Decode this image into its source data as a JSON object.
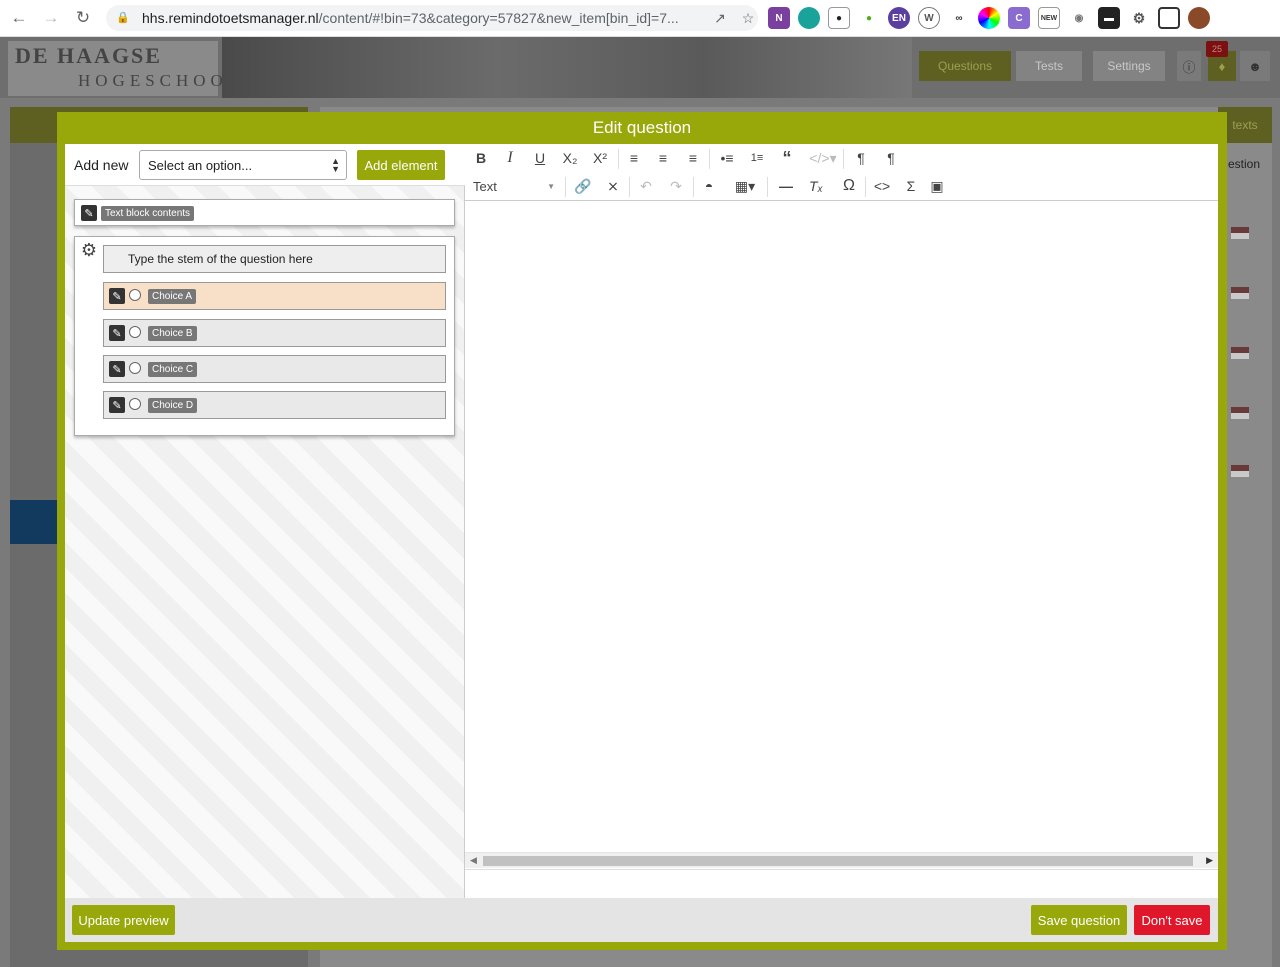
{
  "browser": {
    "url_main": "hhs.remindotoetsmanager.nl",
    "url_rest": "/content/#!bin=73&category=57827&new_item[bin_id]=7..."
  },
  "app": {
    "logo_line1": "DE HAAGSE",
    "logo_line2": "HOGESCHOOL",
    "nav": {
      "questions": "Questions",
      "tests": "Tests",
      "settings": "Settings"
    },
    "notification_count": "25",
    "right_tab_1": "texts",
    "right_tab_2": "estion"
  },
  "modal": {
    "title": "Edit question",
    "add_new_label": "Add new",
    "select_placeholder": "Select an option...",
    "add_element_label": "Add element",
    "text_block_label": "Text block contents",
    "stem_text": "Type the stem of the question here",
    "choices": [
      "Choice A",
      "Choice B",
      "Choice C",
      "Choice D"
    ],
    "editor": {
      "format_value": "Text"
    },
    "footer": {
      "update_preview": "Update preview",
      "save_question": "Save question",
      "dont_save": "Don't save"
    }
  },
  "colors": {
    "accent": "#98a80a",
    "danger": "#e0162b",
    "active_choice": "#f8e0c8"
  }
}
